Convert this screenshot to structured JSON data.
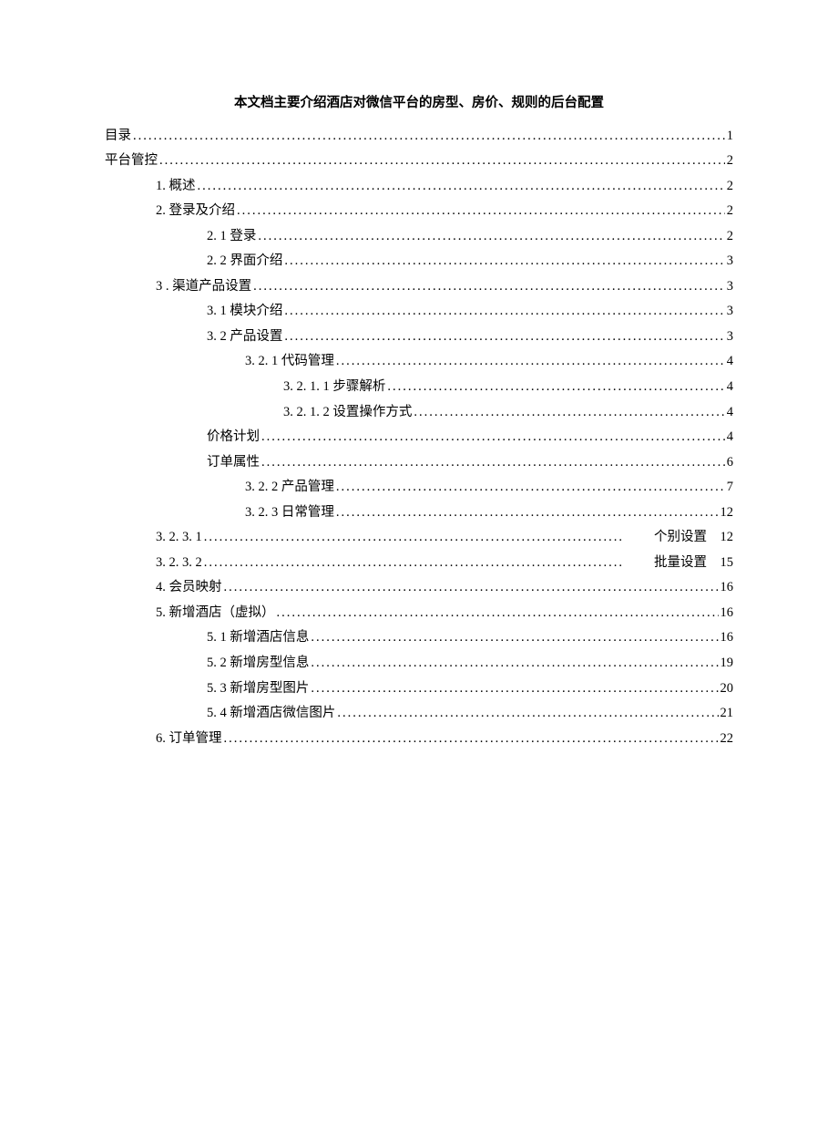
{
  "title": "本文档主要介绍酒店对微信平台的房型、房价、规则的后台配置",
  "toc": [
    {
      "label": "目录",
      "page": "1",
      "level": 0
    },
    {
      "label": "平台管控",
      "page": "2",
      "level": 0
    },
    {
      "label": "1. 概述",
      "page": "2",
      "level": 1
    },
    {
      "label": "2. 登录及介绍",
      "page": "2",
      "level": 1
    },
    {
      "label": "2. 1 登录",
      "page": "2",
      "level": 2
    },
    {
      "label": "2. 2 界面介绍",
      "page": "3",
      "level": 2
    },
    {
      "label": "3 . 渠道产品设置",
      "page": "3",
      "level": 1
    },
    {
      "label": "3. 1 模块介绍",
      "page": "3",
      "level": 2
    },
    {
      "label": "3. 2 产品设置",
      "page": "3",
      "level": 2
    },
    {
      "label": "3. 2. 1 代码管理",
      "page": "4",
      "level": 3
    },
    {
      "label": "3. 2. 1. 1 步骤解析",
      "page": "4",
      "level": 4
    },
    {
      "label": "3. 2. 1. 2 设置操作方式",
      "page": "4",
      "level": 4
    },
    {
      "label": "价格计划",
      "page": "4",
      "level": 2
    },
    {
      "label": "订单属性",
      "page": "6",
      "level": 2
    },
    {
      "label": "3. 2. 2 产品管理",
      "page": "7",
      "level": 3
    },
    {
      "label": "3. 2. 3 日常管理",
      "page": "12",
      "level": 3
    },
    {
      "label": "3. 2. 3. 1",
      "pageLabel": "个别设置　12",
      "level": 1,
      "rtl": true
    },
    {
      "label": "3. 2. 3. 2",
      "pageLabel": "批量设置　15",
      "level": 1,
      "rtl": true
    },
    {
      "label": "4. 会员映射",
      "page": "16",
      "level": 1
    },
    {
      "label": "5. 新增酒店（虚拟）",
      "page": "16",
      "level": 1
    },
    {
      "label": "5. 1 新增酒店信息",
      "page": "16",
      "level": 2
    },
    {
      "label": "5. 2 新增房型信息",
      "page": "19",
      "level": 2
    },
    {
      "label": "5. 3 新增房型图片",
      "page": "20",
      "level": 2
    },
    {
      "label": "5. 4 新增酒店微信图片",
      "page": "21",
      "level": 2
    },
    {
      "label": "6. 订单管理",
      "page": "22",
      "level": 1
    }
  ]
}
